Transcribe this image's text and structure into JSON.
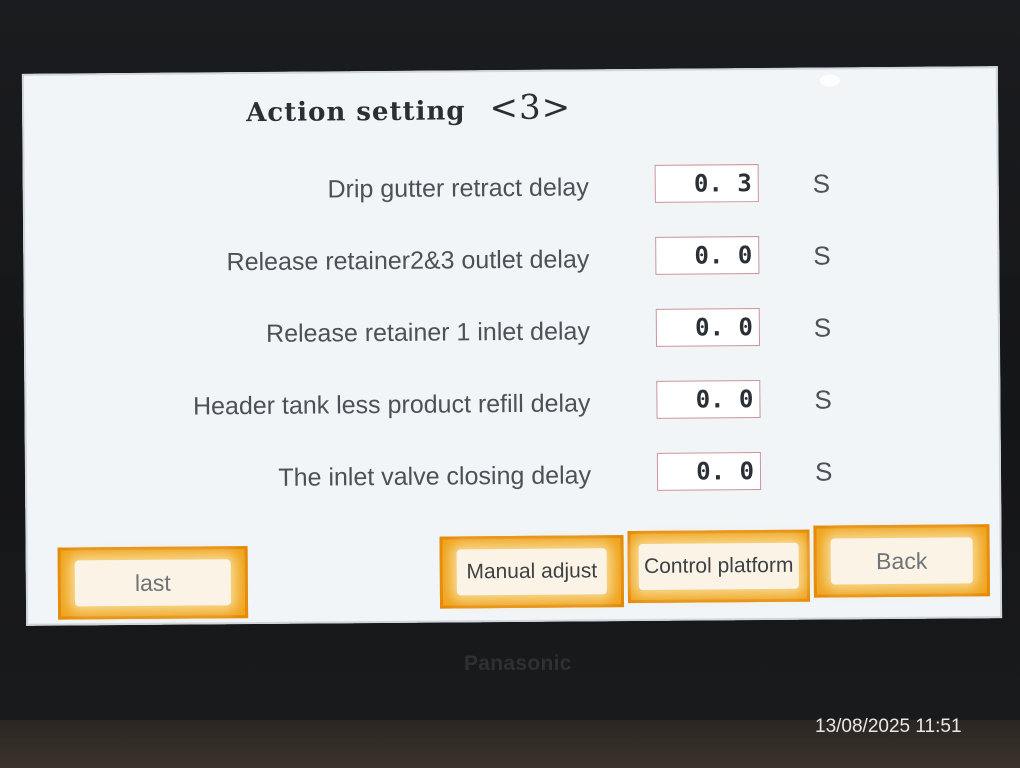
{
  "screen": {
    "title": "Action setting",
    "page_indicator": "<3>"
  },
  "settings": [
    {
      "label": "Drip gutter retract delay",
      "value": "0. 3",
      "unit": "S"
    },
    {
      "label": "Release retainer2&3 outlet delay",
      "value": "0. 0",
      "unit": "S"
    },
    {
      "label": "Release retainer 1 inlet delay",
      "value": "0. 0",
      "unit": "S"
    },
    {
      "label": "Header tank less product refill delay",
      "value": "0. 0",
      "unit": "S"
    },
    {
      "label": "The inlet valve closing delay",
      "value": "0. 0",
      "unit": "S"
    }
  ],
  "buttons": {
    "last": "last",
    "manual_adjust": "Manual adjust",
    "control_platform": "Control platform",
    "back": "Back"
  },
  "device": {
    "brand": "Panasonic"
  },
  "photo": {
    "timestamp": "13/08/2025 11:51"
  },
  "colors": {
    "screen_background": "#f1f5f8",
    "button_orange": "#f0a41d",
    "value_border": "#c9949a",
    "bezel": "#141517"
  }
}
